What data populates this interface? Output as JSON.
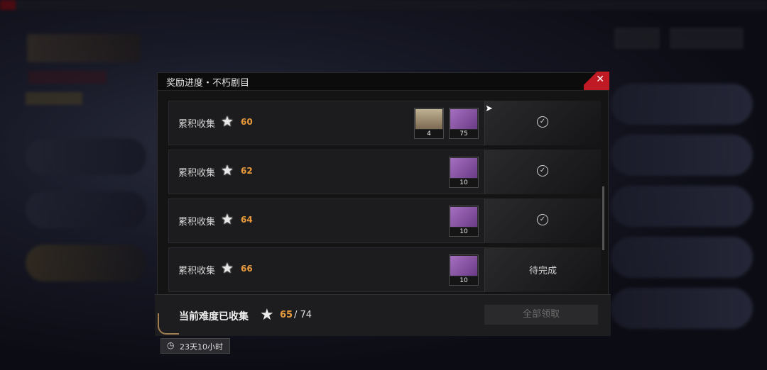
{
  "dialog": {
    "title": "奖励进度・不朽剧目",
    "close": "✕"
  },
  "rows": [
    {
      "label": "累积收集",
      "stars": "60",
      "items": [
        {
          "icon": "character-portrait",
          "qty": "4"
        },
        {
          "icon": "supply-box",
          "qty": "75"
        }
      ],
      "status": "claimed"
    },
    {
      "label": "累积收集",
      "stars": "62",
      "items": [
        {
          "icon": "supply-box",
          "qty": "10"
        }
      ],
      "status": "claimed"
    },
    {
      "label": "累积收集",
      "stars": "64",
      "items": [
        {
          "icon": "supply-box",
          "qty": "10"
        }
      ],
      "status": "claimed"
    },
    {
      "label": "累积收集",
      "stars": "66",
      "items": [
        {
          "icon": "supply-box",
          "qty": "10"
        }
      ],
      "status": "待完成"
    }
  ],
  "footer": {
    "label": "当前难度已收集",
    "collected": "65",
    "total": "/ 74",
    "claim_all": "全部领取"
  },
  "timer": {
    "text": "23天10小时"
  },
  "colors": {
    "accent_orange": "#e89a3c",
    "close_red": "#c01a24"
  }
}
